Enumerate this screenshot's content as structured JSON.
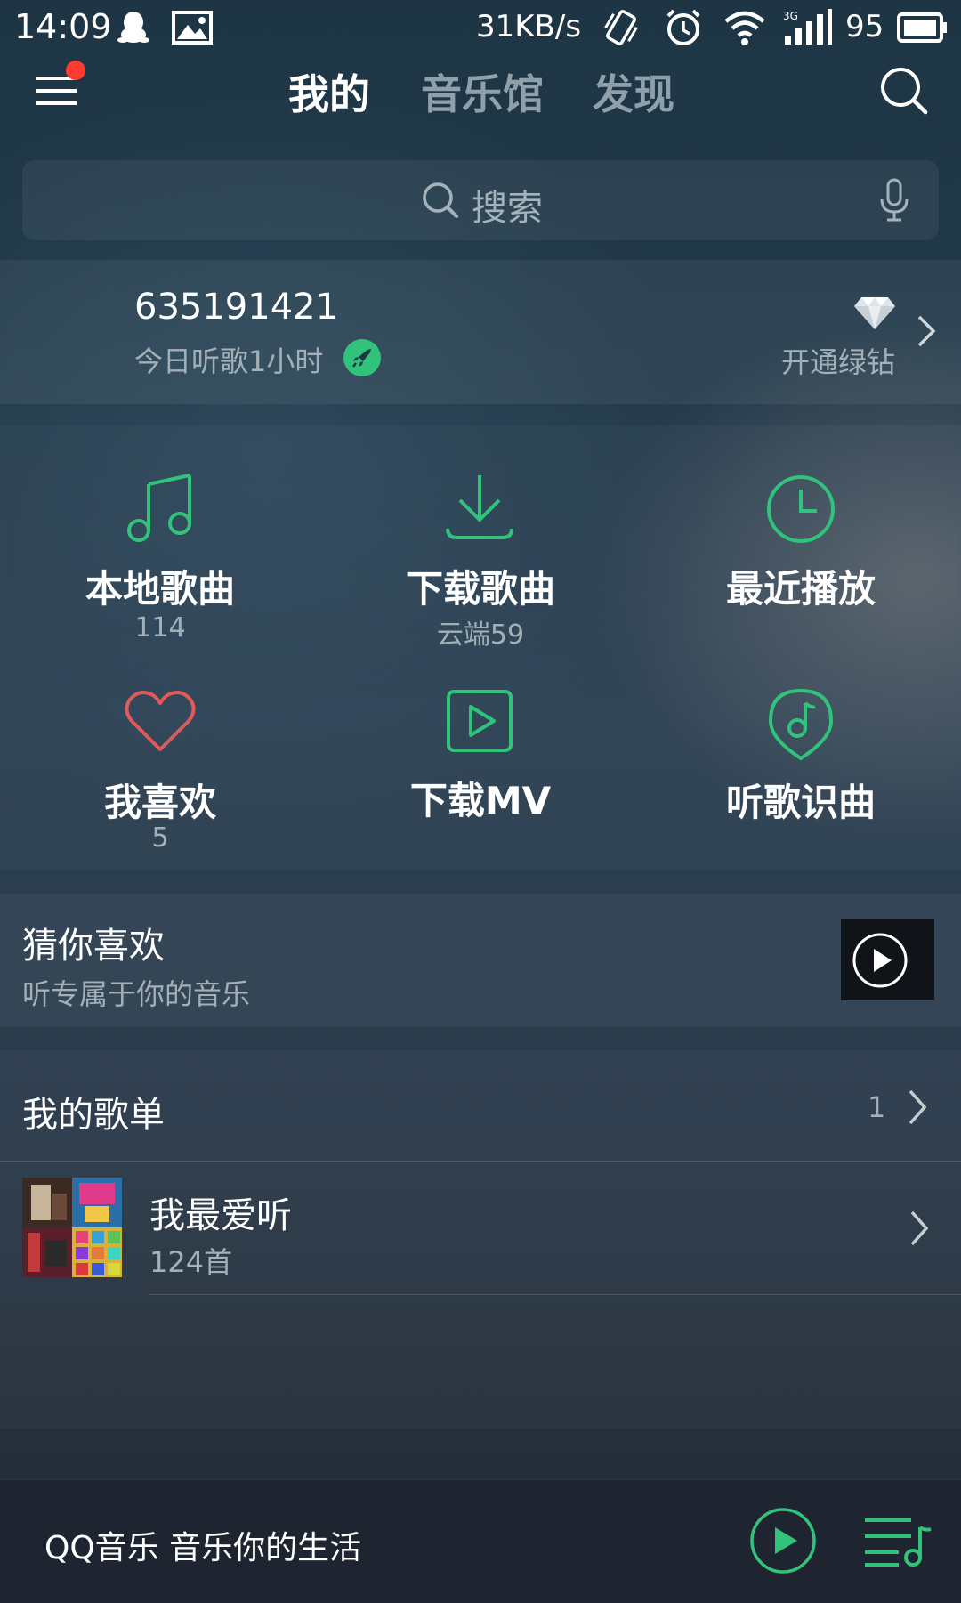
{
  "status_bar": {
    "time": "14:09",
    "network_speed": "31KB/s",
    "battery": "95",
    "icons": [
      "qq-icon",
      "image-icon",
      "vibrate-icon",
      "alarm-icon",
      "wifi-icon",
      "signal-3g-icon",
      "battery-icon"
    ]
  },
  "header": {
    "tabs": [
      {
        "label": "我的",
        "active": true
      },
      {
        "label": "音乐馆",
        "active": false
      },
      {
        "label": "发现",
        "active": false
      }
    ],
    "notification_dot_color": "#ff3b30"
  },
  "search": {
    "placeholder": "搜索"
  },
  "account": {
    "user_id": "635191421",
    "listen_today": "今日听歌1小时",
    "vip_label": "开通绿钻"
  },
  "grid": [
    {
      "label": "本地歌曲",
      "sub": "114",
      "icon": "music-note-icon"
    },
    {
      "label": "下载歌曲",
      "sub": "云端59",
      "icon": "download-icon"
    },
    {
      "label": "最近播放",
      "sub": "",
      "icon": "clock-icon"
    },
    {
      "label": "我喜欢",
      "sub": "5",
      "icon": "heart-icon"
    },
    {
      "label": "下载MV",
      "sub": "",
      "icon": "video-play-icon"
    },
    {
      "label": "听歌识曲",
      "sub": "",
      "icon": "music-recognize-icon"
    }
  ],
  "guess": {
    "title": "猜你喜欢",
    "subtitle": "听专属于你的音乐"
  },
  "playlists": {
    "header": "我的歌单",
    "count": "1",
    "items": [
      {
        "name": "我最爱听",
        "songs": "124首"
      }
    ]
  },
  "player": {
    "text": "QQ音乐 音乐你的生活"
  },
  "colors": {
    "accent_green": "#31c27c",
    "heart_red": "#e05a5a",
    "text_secondary": "#a4b0b8"
  }
}
